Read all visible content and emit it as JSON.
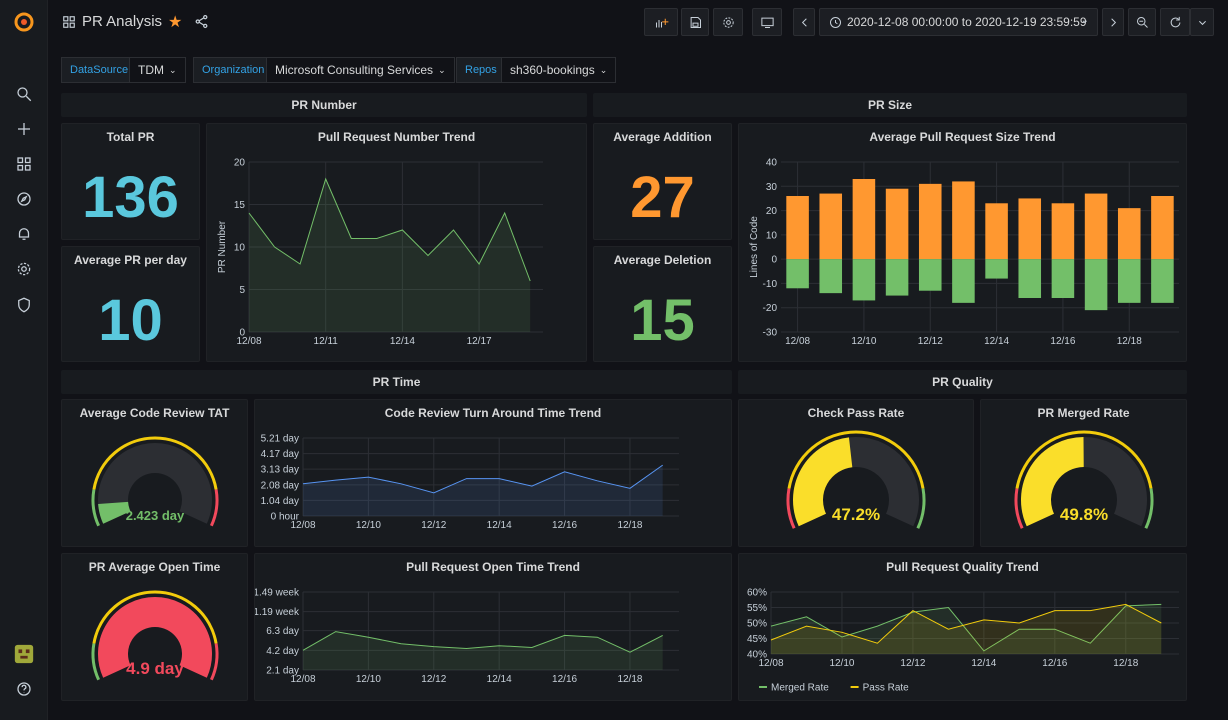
{
  "header": {
    "title": "PR Analysis",
    "time_range": "2020-12-08 00:00:00 to 2020-12-19 23:59:59"
  },
  "variables": [
    {
      "label": "DataSource",
      "value": "TDM"
    },
    {
      "label": "Organization",
      "value": "Microsoft Consulting Services"
    },
    {
      "label": "Repos",
      "value": "sh360-bookings"
    }
  ],
  "rows": {
    "pr_number": "PR Number",
    "pr_size": "PR Size",
    "pr_time": "PR Time",
    "pr_quality": "PR Quality"
  },
  "stats": {
    "total_pr": {
      "title": "Total PR",
      "value": "136",
      "color": "#5ac8dd"
    },
    "avg_pr_per_day": {
      "title": "Average PR per day",
      "value": "10",
      "color": "#5ac8dd"
    },
    "avg_addition": {
      "title": "Average Addition",
      "value": "27",
      "color": "#ff9830"
    },
    "avg_deletion": {
      "title": "Average Deletion",
      "value": "15",
      "color": "#73bf69"
    }
  },
  "gauges": {
    "review_tat": {
      "title": "Average Code Review TAT",
      "value_text": "2.423 day",
      "fraction": 0.09,
      "color": "#73bf69"
    },
    "check_pass": {
      "title": "Check Pass Rate",
      "value_text": "47.2%",
      "fraction": 0.472,
      "color": "#fade2a"
    },
    "merged_rate": {
      "title": "PR Merged Rate",
      "value_text": "49.8%",
      "fraction": 0.498,
      "color": "#fade2a"
    },
    "open_time": {
      "title": "PR Average Open Time",
      "value_text": "4.9 day",
      "fraction": 1.0,
      "color": "#f2495c"
    }
  },
  "chart_data": [
    {
      "id": "pr_number_trend",
      "type": "area",
      "title": "Pull Request Number Trend",
      "ylabel": "PR Number",
      "x": [
        0,
        1,
        2,
        3,
        4,
        5,
        6,
        7,
        8,
        9,
        10,
        11
      ],
      "xticks": [
        {
          "x": 0,
          "label": "12/08"
        },
        {
          "x": 3,
          "label": "12/11"
        },
        {
          "x": 6,
          "label": "12/14"
        },
        {
          "x": 9,
          "label": "12/17"
        }
      ],
      "series": [
        {
          "values": [
            14,
            10,
            8,
            18,
            11,
            11,
            12,
            9,
            12,
            8,
            14,
            6
          ],
          "color": "#73bf69"
        }
      ],
      "ylim": [
        0,
        20
      ],
      "yticks": [
        {
          "v": 0,
          "label": "0"
        },
        {
          "v": 5,
          "label": "5"
        },
        {
          "v": 10,
          "label": "10"
        },
        {
          "v": 15,
          "label": "15"
        },
        {
          "v": 20,
          "label": "20"
        }
      ]
    },
    {
      "id": "pr_size_trend",
      "type": "bar",
      "title": "Average Pull Request Size Trend",
      "ylabel": "Lines of Code",
      "categories": [
        "12/08",
        "12/09",
        "12/10",
        "12/11",
        "12/12",
        "12/13",
        "12/14",
        "12/15",
        "12/16",
        "12/17",
        "12/18",
        "12/19"
      ],
      "xticks": [
        {
          "x": 0,
          "label": "12/08"
        },
        {
          "x": 2,
          "label": "12/10"
        },
        {
          "x": 4,
          "label": "12/12"
        },
        {
          "x": 6,
          "label": "12/14"
        },
        {
          "x": 8,
          "label": "12/16"
        },
        {
          "x": 10,
          "label": "12/18"
        }
      ],
      "series": [
        {
          "values": [
            26,
            27,
            33,
            29,
            31,
            32,
            23,
            25,
            23,
            27,
            21,
            26
          ],
          "color": "#ff9830"
        },
        {
          "values": [
            -12,
            -14,
            -17,
            -15,
            -13,
            -18,
            -8,
            -16,
            -16,
            -21,
            -18,
            -18
          ],
          "color": "#73bf69"
        }
      ],
      "ylim": [
        -30,
        40
      ],
      "yticks": [
        {
          "v": -30,
          "label": "-30"
        },
        {
          "v": -20,
          "label": "-20"
        },
        {
          "v": -10,
          "label": "-10"
        },
        {
          "v": 0,
          "label": "0"
        },
        {
          "v": 10,
          "label": "10"
        },
        {
          "v": 20,
          "label": "20"
        },
        {
          "v": 30,
          "label": "30"
        },
        {
          "v": 40,
          "label": "40"
        }
      ]
    },
    {
      "id": "review_tat_trend",
      "type": "area",
      "title": "Code Review Turn Around Time Trend",
      "ylabel": "",
      "x": [
        0,
        1,
        2,
        3,
        4,
        5,
        6,
        7,
        8,
        9,
        10,
        11
      ],
      "xticks": [
        {
          "x": 0,
          "label": "12/08"
        },
        {
          "x": 2,
          "label": "12/10"
        },
        {
          "x": 4,
          "label": "12/12"
        },
        {
          "x": 6,
          "label": "12/14"
        },
        {
          "x": 8,
          "label": "12/16"
        },
        {
          "x": 10,
          "label": "12/18"
        }
      ],
      "series": [
        {
          "values": [
            2.15,
            2.4,
            2.6,
            2.15,
            1.55,
            2.5,
            2.5,
            2.0,
            2.95,
            2.35,
            1.85,
            3.4
          ],
          "color": "#5794f2"
        }
      ],
      "ylim": [
        0,
        5.21
      ],
      "yticks": [
        {
          "v": 0,
          "label": "0 hour"
        },
        {
          "v": 1.04,
          "label": "1.04 day"
        },
        {
          "v": 2.08,
          "label": "2.08 day"
        },
        {
          "v": 3.13,
          "label": "3.13 day"
        },
        {
          "v": 4.17,
          "label": "4.17 day"
        },
        {
          "v": 5.21,
          "label": "5.21 day"
        }
      ]
    },
    {
      "id": "open_time_trend",
      "type": "area",
      "title": "Pull Request Open Time Trend",
      "ylabel": "",
      "x": [
        0,
        1,
        2,
        3,
        4,
        5,
        6,
        7,
        8,
        9,
        10,
        11
      ],
      "xticks": [
        {
          "x": 0,
          "label": "12/08"
        },
        {
          "x": 2,
          "label": "12/10"
        },
        {
          "x": 4,
          "label": "12/12"
        },
        {
          "x": 6,
          "label": "12/14"
        },
        {
          "x": 8,
          "label": "12/16"
        },
        {
          "x": 10,
          "label": "12/18"
        }
      ],
      "series": [
        {
          "values": [
            4.2,
            6.2,
            5.6,
            4.9,
            4.6,
            4.4,
            4.7,
            4.5,
            5.8,
            5.6,
            4.0,
            5.8
          ],
          "color": "#73bf69"
        }
      ],
      "ylim": [
        2.1,
        10.43
      ],
      "yticks": [
        {
          "v": 2.1,
          "label": "2.1 day"
        },
        {
          "v": 4.2,
          "label": "4.2 day"
        },
        {
          "v": 6.3,
          "label": "6.3 day"
        },
        {
          "v": 8.33,
          "label": "1.19 week"
        },
        {
          "v": 10.43,
          "label": "1.49 week"
        }
      ]
    },
    {
      "id": "quality_trend",
      "type": "area",
      "title": "Pull Request Quality Trend",
      "ylabel": "",
      "x": [
        0,
        1,
        2,
        3,
        4,
        5,
        6,
        7,
        8,
        9,
        10,
        11
      ],
      "xticks": [
        {
          "x": 0,
          "label": "12/08"
        },
        {
          "x": 2,
          "label": "12/10"
        },
        {
          "x": 4,
          "label": "12/12"
        },
        {
          "x": 6,
          "label": "12/14"
        },
        {
          "x": 8,
          "label": "12/16"
        },
        {
          "x": 10,
          "label": "12/18"
        }
      ],
      "series": [
        {
          "name": "Merged Rate",
          "values": [
            49,
            52,
            45.5,
            49,
            53.5,
            55,
            41,
            48,
            48,
            43.5,
            55.5,
            56
          ],
          "color": "#73bf69"
        },
        {
          "name": "Pass Rate",
          "values": [
            44.5,
            49,
            47,
            43.5,
            54,
            48,
            51,
            50,
            54,
            54,
            56,
            50
          ],
          "color": "#f2cc0c"
        }
      ],
      "ylim": [
        40,
        60
      ],
      "yticks": [
        {
          "v": 40,
          "label": "40%"
        },
        {
          "v": 45,
          "label": "45%"
        },
        {
          "v": 50,
          "label": "50%"
        },
        {
          "v": 55,
          "label": "55%"
        },
        {
          "v": 60,
          "label": "60%"
        }
      ]
    }
  ]
}
